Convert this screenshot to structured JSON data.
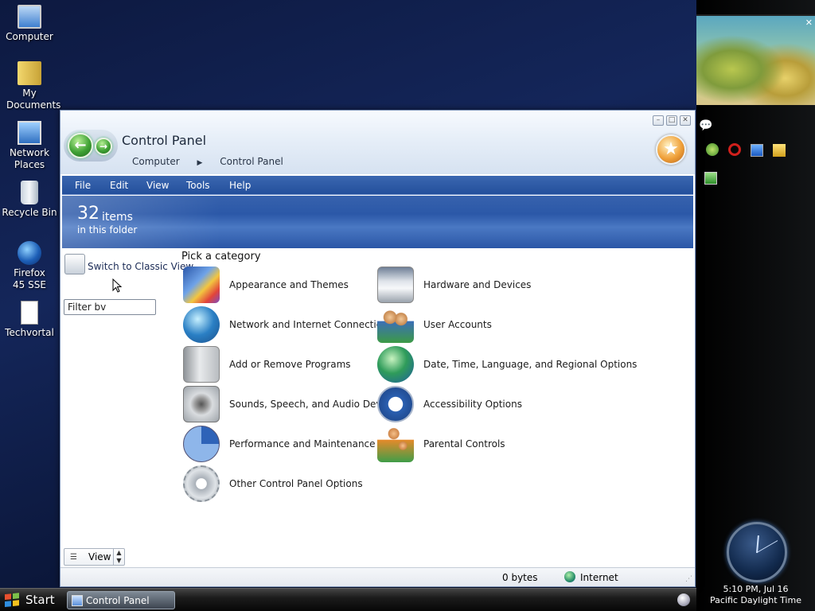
{
  "desktop": {
    "icons": [
      {
        "label": "Computer"
      },
      {
        "label": "My Documents"
      },
      {
        "label": "Network Places"
      },
      {
        "label": "Recycle Bin"
      },
      {
        "label": "Firefox 45 SSE"
      },
      {
        "label": "Techvortal"
      }
    ]
  },
  "window": {
    "title": "Control Panel",
    "breadcrumb": [
      "Computer",
      "Control Panel"
    ],
    "controls": [
      "minimize",
      "maximize",
      "close"
    ]
  },
  "menu": {
    "items": [
      "File",
      "Edit",
      "View",
      "Tools",
      "Help"
    ]
  },
  "banner": {
    "count": "32",
    "word": "items",
    "sub": "in this folder"
  },
  "left_pane": {
    "classic_view_link": "Switch to Classic View",
    "filter_value": "Filter bv",
    "view_button": "View"
  },
  "categories": {
    "heading": "Pick a category",
    "left": [
      {
        "label": "Appearance and Themes",
        "icon": "appearance-themes-icon"
      },
      {
        "label": "Network and Internet Connections",
        "icon": "network-internet-icon"
      },
      {
        "label": "Add or Remove Programs",
        "icon": "add-remove-programs-icon"
      },
      {
        "label": "Sounds, Speech, and Audio Devices",
        "icon": "sounds-audio-icon"
      },
      {
        "label": "Performance and Maintenance",
        "icon": "performance-maintenance-icon"
      },
      {
        "label": "Other Control Panel Options",
        "icon": "other-options-gear-icon"
      }
    ],
    "right": [
      {
        "label": "Hardware and Devices",
        "icon": "hardware-devices-icon"
      },
      {
        "label": "User Accounts",
        "icon": "user-accounts-icon"
      },
      {
        "label": "Date, Time, Language, and Regional Options",
        "icon": "date-time-globe-icon"
      },
      {
        "label": "Accessibility Options",
        "icon": "accessibility-icon"
      },
      {
        "label": "Parental Controls",
        "icon": "parental-controls-icon"
      }
    ]
  },
  "status": {
    "size": "0 bytes",
    "zone": "Internet"
  },
  "taskbar": {
    "start": "Start",
    "task": "Control Panel"
  },
  "sidebar": {
    "time": "5:10 PM, Jul 16",
    "timezone": "Pacific Daylight Time"
  },
  "colors": {
    "menu_bar": "#2b58a8",
    "banner": "#3762ad",
    "desktop": "#0d1940"
  }
}
